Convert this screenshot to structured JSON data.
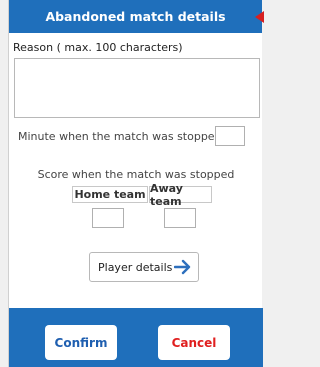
{
  "dialog": {
    "title": "Abandoned match details",
    "reason_label": "Reason ( max. 100 characters)",
    "reason_value": "",
    "minute_label": "Minute when the match was stopped",
    "minute_value": "",
    "score_label": "Score when the match was stopped",
    "home_team_label": "Home team",
    "away_team_label": "Away team",
    "home_score_value": "",
    "away_score_value": "",
    "player_details_label": "Player details",
    "confirm_label": "Confirm",
    "cancel_label": "Cancel"
  },
  "colors": {
    "header": "#1f6fbb",
    "close_arrow": "#d62020",
    "confirm_text": "#1f5fb0",
    "cancel_text": "#e02020"
  }
}
